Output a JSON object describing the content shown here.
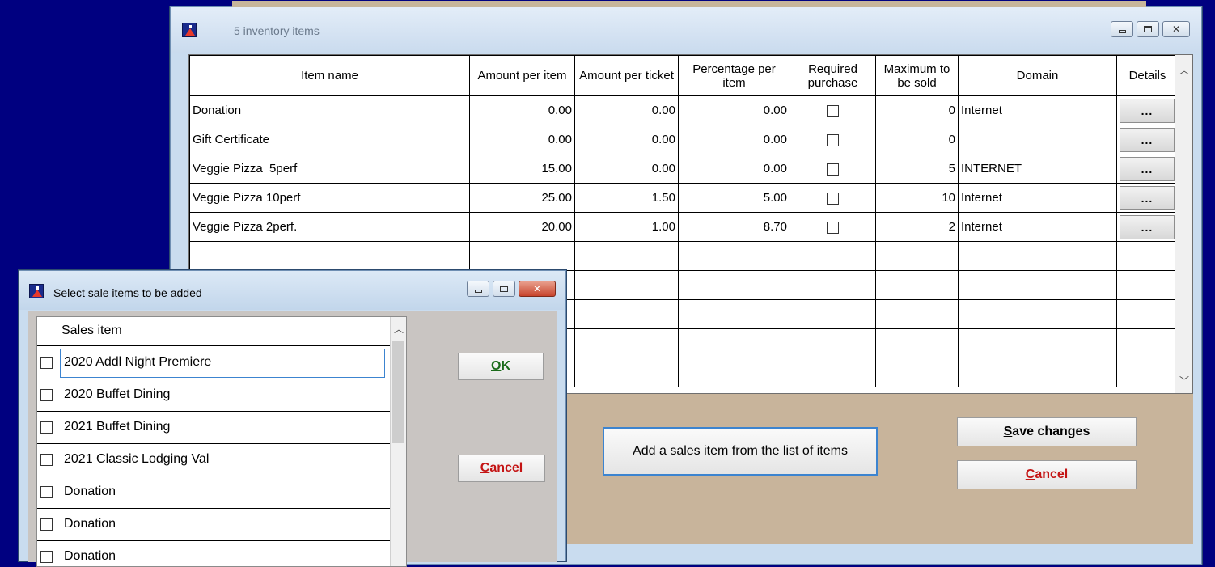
{
  "main_window": {
    "title": "5 inventory items",
    "columns": [
      "Item name",
      "Amount per item",
      "Amount per ticket",
      "Percentage per item",
      "Required purchase",
      "Maximum to be sold",
      "Domain",
      "Details"
    ],
    "rows": [
      {
        "name": "Donation",
        "amount_item": "0.00",
        "amount_ticket": "0.00",
        "percentage": "0.00",
        "max": "0",
        "domain": "Internet",
        "details": "..."
      },
      {
        "name": "Gift Certificate",
        "amount_item": "0.00",
        "amount_ticket": "0.00",
        "percentage": "0.00",
        "max": "0",
        "domain": "",
        "details": "..."
      },
      {
        "name": "Veggie Pizza  5perf",
        "amount_item": "15.00",
        "amount_ticket": "0.00",
        "percentage": "0.00",
        "max": "5",
        "domain": "INTERNET",
        "details": "..."
      },
      {
        "name": "Veggie Pizza 10perf",
        "amount_item": "25.00",
        "amount_ticket": "1.50",
        "percentage": "5.00",
        "max": "10",
        "domain": "Internet",
        "details": "..."
      },
      {
        "name": "Veggie Pizza 2perf.",
        "amount_item": "20.00",
        "amount_ticket": "1.00",
        "percentage": "8.70",
        "max": "2",
        "domain": "Internet",
        "details": "..."
      }
    ],
    "add_button": "Add a sales item from the list of items",
    "save_button": {
      "key": "S",
      "rest": "ave changes"
    },
    "cancel_button": {
      "key": "C",
      "rest": "ancel"
    }
  },
  "dialog": {
    "title": "Select sale items to be added",
    "column": "Sales item",
    "items": [
      "2020 Addl Night Premiere",
      "2020 Buffet Dining",
      "2021 Buffet Dining",
      "2021 Classic Lodging Val",
      "Donation",
      "Donation",
      "Donation"
    ],
    "ok_button": {
      "key": "O",
      "rest": "K"
    },
    "cancel_button": {
      "key": "C",
      "rest": "ancel"
    }
  },
  "icons": {
    "app": "app-icon",
    "minimize": "minimize-icon",
    "maximize": "maximize-icon",
    "close": "close-icon",
    "scroll_up": "scroll-up-icon",
    "scroll_down": "scroll-down-icon"
  }
}
